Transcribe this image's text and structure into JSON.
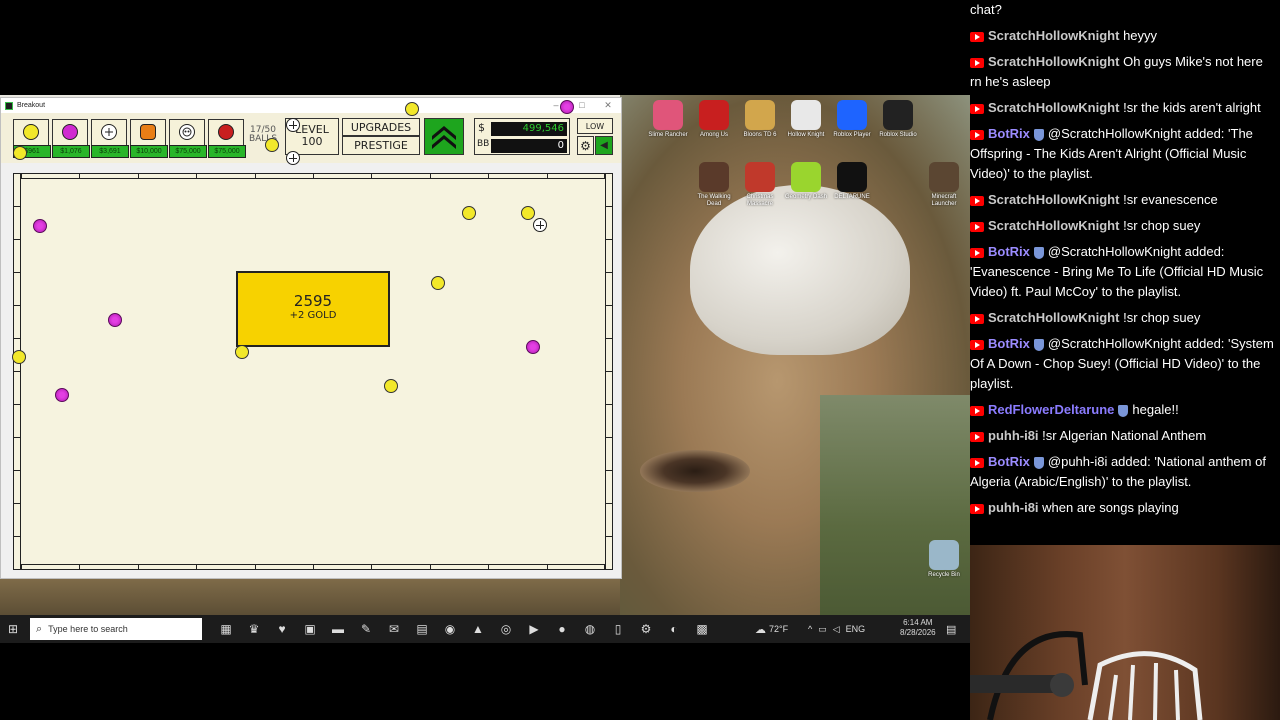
{
  "game_window": {
    "title": "Breakout",
    "controls": [
      "–",
      "□",
      "✕"
    ],
    "shop": [
      {
        "price": "$961",
        "ball": "yellow"
      },
      {
        "price": "$1,076",
        "ball": "pink"
      },
      {
        "price": "$3,691",
        "ball": "plus"
      },
      {
        "price": "$10,000",
        "ball": "orange"
      },
      {
        "price": "$75,000",
        "ball": "skull"
      },
      {
        "price": "$75,000",
        "ball": "red"
      }
    ],
    "balls_count": "17/50",
    "balls_label": "BALLS",
    "level_label": "LEVEL",
    "level_value": "100",
    "upgrades_label": "UPGRADES",
    "prestige_label": "PRESTIGE",
    "money_symbol": "$",
    "money_value": "499,546",
    "bb_label": "BB",
    "bb_value": "0",
    "quality_label": "LOW",
    "brick_value": "2595",
    "brick_reward": "+2 GOLD"
  },
  "desktop_icons": [
    {
      "label": "Slime Rancher",
      "color": "#e0557a"
    },
    {
      "label": "Among Us",
      "color": "#c81f1f"
    },
    {
      "label": "Bloons TD 6",
      "color": "#d2a64c"
    },
    {
      "label": "Hollow Knight",
      "color": "#e8e8e8"
    },
    {
      "label": "Roblox Player",
      "color": "#1e64ff"
    },
    {
      "label": "Roblox Studio",
      "color": "#222222"
    },
    {
      "label": "The Walking Dead",
      "color": "#5a3a2a"
    },
    {
      "label": "Christmas Massacre",
      "color": "#c0392b"
    },
    {
      "label": "Geometry Dash",
      "color": "#9ad52e"
    },
    {
      "label": "DELTARUNE",
      "color": "#111111"
    },
    {
      "label": "Minecraft Launcher",
      "color": "#5b4632"
    },
    {
      "label": "Recycle Bin",
      "color": "#9ab7c9"
    }
  ],
  "taskbar": {
    "search_placeholder": "Type here to search",
    "temperature": "72°F",
    "language": "ENG",
    "time": "6:14 AM",
    "date": "8/28/2026"
  },
  "chat": [
    {
      "user": "",
      "text": "chat?",
      "bot": false
    },
    {
      "user": "ScratchHollowKnight",
      "text": "heyyy",
      "bot": false
    },
    {
      "user": "ScratchHollowKnight",
      "text": "Oh guys Mike's not here rn he's asleep",
      "bot": false
    },
    {
      "user": "ScratchHollowKnight",
      "text": "!sr the kids aren't alright",
      "bot": false
    },
    {
      "user": "BotRix",
      "text": "@ScratchHollowKnight added: 'The Offspring - The Kids Aren't Alright (Official Music Video)' to the playlist.",
      "bot": true
    },
    {
      "user": "ScratchHollowKnight",
      "text": "!sr evanescence",
      "bot": false
    },
    {
      "user": "ScratchHollowKnight",
      "text": "!sr chop suey",
      "bot": false
    },
    {
      "user": "BotRix",
      "text": "@ScratchHollowKnight added: 'Evanescence - Bring Me To Life (Official HD Music Video) ft. Paul McCoy' to the playlist.",
      "bot": true
    },
    {
      "user": "ScratchHollowKnight",
      "text": "!sr chop suey",
      "bot": false
    },
    {
      "user": "BotRix",
      "text": "@ScratchHollowKnight added: 'System Of A Down - Chop Suey! (Official HD Video)' to the playlist.",
      "bot": true
    },
    {
      "user": "RedFlowerDeltarune",
      "text": "hegale!!",
      "bot": true
    },
    {
      "user": "puhh-i8i",
      "text": "!sr Algerian National Anthem",
      "bot": false
    },
    {
      "user": "BotRix",
      "text": "@puhh-i8i added: 'National anthem of Algeria (Arabic/English)' to the playlist.",
      "bot": true
    },
    {
      "user": "puhh-i8i",
      "text": "when are songs playing",
      "bot": false
    }
  ],
  "colors": {
    "chat_user": "#c9c9c9",
    "chat_user_bot": "#9b8cff",
    "chat_user_red": "#8b7cff",
    "money_green": "#2ecc2e"
  }
}
